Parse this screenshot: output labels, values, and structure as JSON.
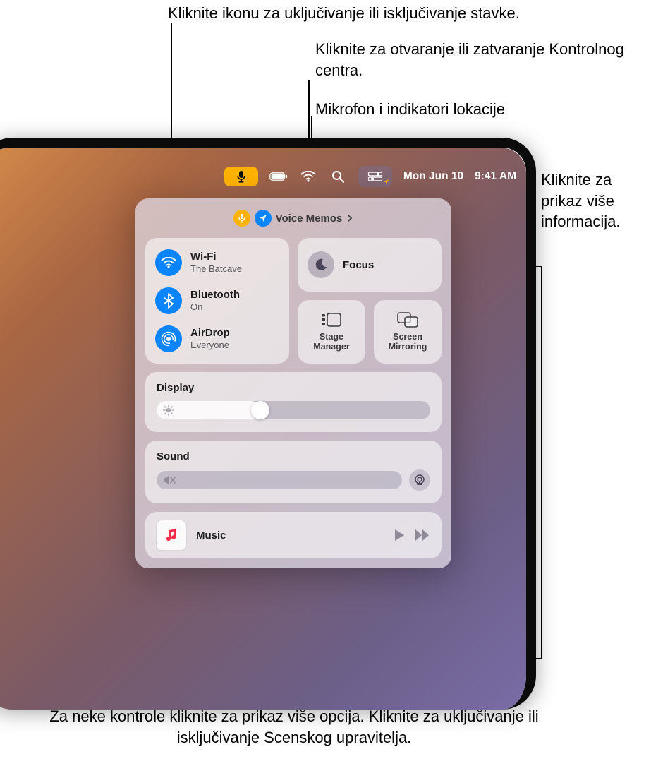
{
  "callouts": {
    "toggle_click": "Kliknite ikonu za uključivanje ili isključivanje stavke.",
    "open_close": "Kliknite za otvaranje ili zatvaranje Kontrolnog centra.",
    "mic_loc_indicators": "Mikrofon i indikatori lokacije",
    "more_info": "Kliknite za prikaz više informacija.",
    "bottom": "Za neke kontrole kliknite za prikaz više opcija. Kliknite za uključivanje ili isključivanje Scenskog upravitelja."
  },
  "menubar": {
    "date": "Mon Jun 10",
    "time": "9:41 AM"
  },
  "indicators": {
    "app_name": "Voice Memos"
  },
  "connectivity": {
    "wifi": {
      "title": "Wi-Fi",
      "sub": "The Batcave"
    },
    "bluetooth": {
      "title": "Bluetooth",
      "sub": "On"
    },
    "airdrop": {
      "title": "AirDrop",
      "sub": "Everyone"
    }
  },
  "focus": {
    "title": "Focus"
  },
  "stage": {
    "label1": "Stage",
    "label2": "Manager"
  },
  "mirror": {
    "label1": "Screen",
    "label2": "Mirroring"
  },
  "display": {
    "label": "Display",
    "value_pct": 38
  },
  "sound": {
    "label": "Sound",
    "value_pct": 0
  },
  "music": {
    "title": "Music"
  }
}
